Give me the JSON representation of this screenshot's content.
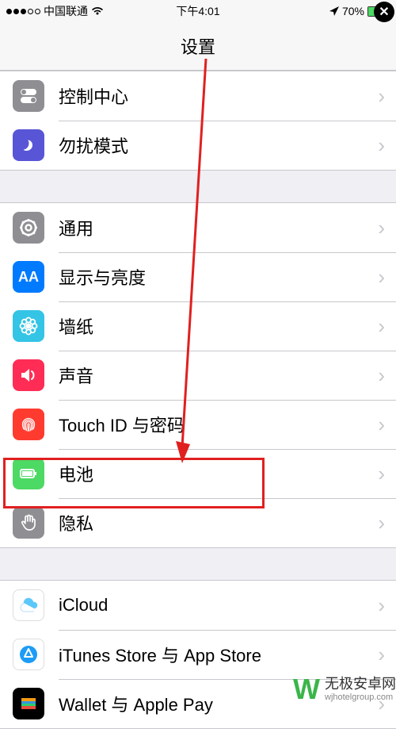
{
  "status": {
    "carrier": "中国联通",
    "time": "下午4:01",
    "battery_pct": "70%"
  },
  "title": "设置",
  "groups": [
    {
      "items": [
        {
          "key": "control-center",
          "label": "控制中心",
          "icon_bg": "#8e8e93",
          "icon_path": "toggle"
        },
        {
          "key": "dnd",
          "label": "勿扰模式",
          "icon_bg": "#5856d6",
          "icon_path": "moon"
        }
      ]
    },
    {
      "items": [
        {
          "key": "general",
          "label": "通用",
          "icon_bg": "#8e8e93",
          "icon_path": "gear"
        },
        {
          "key": "display",
          "label": "显示与亮度",
          "icon_bg": "#007aff",
          "icon_path": "aa"
        },
        {
          "key": "wallpaper",
          "label": "墙纸",
          "icon_bg": "#34c4e5",
          "icon_path": "flower"
        },
        {
          "key": "sound",
          "label": "声音",
          "icon_bg": "#ff2d55",
          "icon_path": "speaker"
        },
        {
          "key": "touchid",
          "label": "Touch ID 与密码",
          "icon_bg": "#ff3b30",
          "icon_path": "fingerprint"
        },
        {
          "key": "battery",
          "label": "电池",
          "icon_bg": "#4cd964",
          "icon_path": "battery"
        },
        {
          "key": "privacy",
          "label": "隐私",
          "icon_bg": "#8e8e93",
          "icon_path": "hand"
        }
      ]
    },
    {
      "items": [
        {
          "key": "icloud",
          "label": "iCloud",
          "icon_bg": "#ffffff",
          "icon_path": "cloud"
        },
        {
          "key": "itunes",
          "label": "iTunes Store 与 App Store",
          "icon_bg": "#ffffff",
          "icon_path": "appstore"
        },
        {
          "key": "wallet",
          "label": "Wallet 与 Apple Pay",
          "icon_bg": "#000000",
          "icon_path": "wallet"
        }
      ]
    }
  ],
  "watermark": {
    "logo": "W",
    "main": "无极安卓网",
    "sub": "wjhotelgroup.com"
  }
}
